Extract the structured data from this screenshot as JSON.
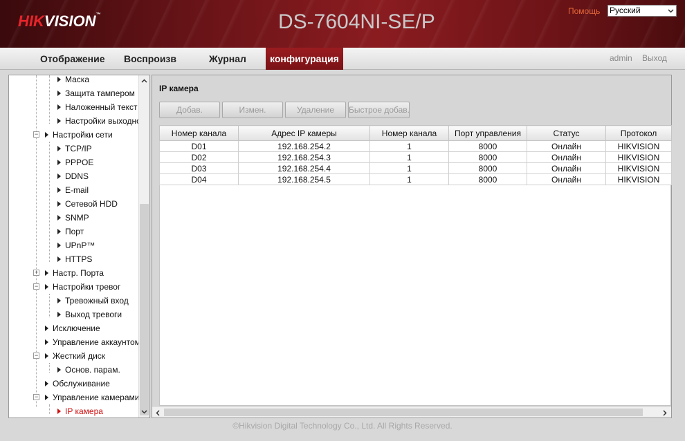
{
  "header": {
    "logo_prefix": "HIK",
    "logo_suffix": "VISION",
    "logo_tm": "™",
    "model": "DS-7604NI-SE/P",
    "help_label": "Помощь",
    "language": "Русский"
  },
  "nav": {
    "items": [
      {
        "label": "Отображение"
      },
      {
        "label": "Воспроизв"
      },
      {
        "label": "Журнал"
      },
      {
        "label": "конфигурация"
      }
    ],
    "user": "admin",
    "logout_label": "Выход"
  },
  "sidebar": {
    "items": [
      {
        "label": "Маска"
      },
      {
        "label": "Защита тампером"
      },
      {
        "label": "Наложенный текст"
      },
      {
        "label": "Настройки выходного"
      },
      {
        "label": "Настройки сети"
      },
      {
        "label": "TCP/IP"
      },
      {
        "label": "PPPOE"
      },
      {
        "label": "DDNS"
      },
      {
        "label": "E-mail"
      },
      {
        "label": "Сетевой HDD"
      },
      {
        "label": "SNMP"
      },
      {
        "label": "Порт"
      },
      {
        "label": "UPnP™"
      },
      {
        "label": "HTTPS"
      },
      {
        "label": "Настр. Порта"
      },
      {
        "label": "Настройки тревог"
      },
      {
        "label": "Тревожный вход"
      },
      {
        "label": "Выход тревоги"
      },
      {
        "label": "Исключение"
      },
      {
        "label": "Управление аккаунтом"
      },
      {
        "label": "Жесткий диск"
      },
      {
        "label": "Основ. парам."
      },
      {
        "label": "Обслуживание"
      },
      {
        "label": "Управление камерами"
      },
      {
        "label": "IP камера"
      }
    ]
  },
  "main": {
    "title": "IP камера",
    "buttons": {
      "add": "Добав.",
      "edit": "Измен.",
      "delete": "Удаление",
      "quick_add": "Быстрое добав."
    },
    "table": {
      "headers": [
        "Номер канала",
        "Адрес IP камеры",
        "Номер канала",
        "Порт управления",
        "Статус",
        "Протокол"
      ],
      "rows": [
        [
          "D01",
          "192.168.254.2",
          "1",
          "8000",
          "Онлайн",
          "HIKVISION"
        ],
        [
          "D02",
          "192.168.254.3",
          "1",
          "8000",
          "Онлайн",
          "HIKVISION"
        ],
        [
          "D03",
          "192.168.254.4",
          "1",
          "8000",
          "Онлайн",
          "HIKVISION"
        ],
        [
          "D04",
          "192.168.254.5",
          "1",
          "8000",
          "Онлайн",
          "HIKVISION"
        ]
      ]
    }
  },
  "footer": {
    "copyright": "©Hikvision Digital Technology Co., Ltd. All Rights Reserved."
  },
  "colors": {
    "brand_red": "#8a1c20",
    "logo_red": "#e8242a",
    "selected_item": "#d01010",
    "help_link": "#e6683a"
  },
  "icons": {
    "expand": "plus-box-icon",
    "collapse": "minus-box-icon",
    "leaf": "triangle-right-icon",
    "dropdown": "chevron-down-icon"
  }
}
